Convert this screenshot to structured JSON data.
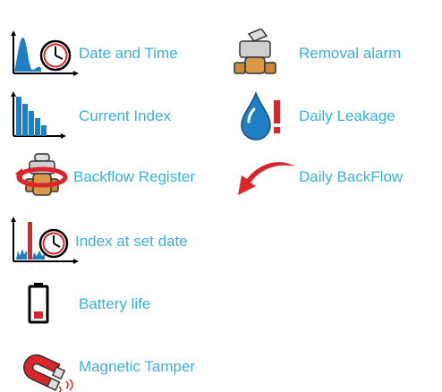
{
  "colors": {
    "label": "#3bb0d8",
    "blue": "#1f7fc2",
    "red": "#d9252b",
    "brass": "#c9883a",
    "black": "#000000"
  },
  "left": [
    {
      "label": "Date and Time",
      "icon": "chart-clock-icon"
    },
    {
      "label": "Current Index",
      "icon": "bar-chart-icon"
    },
    {
      "label": "Backflow Register",
      "icon": "meter-rotate-icon"
    },
    {
      "label": "Index at set date",
      "icon": "spike-chart-clock-icon"
    },
    {
      "label": "Battery life",
      "icon": "battery-icon"
    },
    {
      "label": "Magnetic Tamper",
      "icon": "magnet-icon"
    }
  ],
  "right": [
    {
      "label": "Removal alarm",
      "icon": "meter-removal-icon"
    },
    {
      "label": "Daily Leakage",
      "icon": "drop-alert-icon"
    },
    {
      "label": "Daily BackFlow",
      "icon": "backflow-arrow-icon"
    }
  ]
}
